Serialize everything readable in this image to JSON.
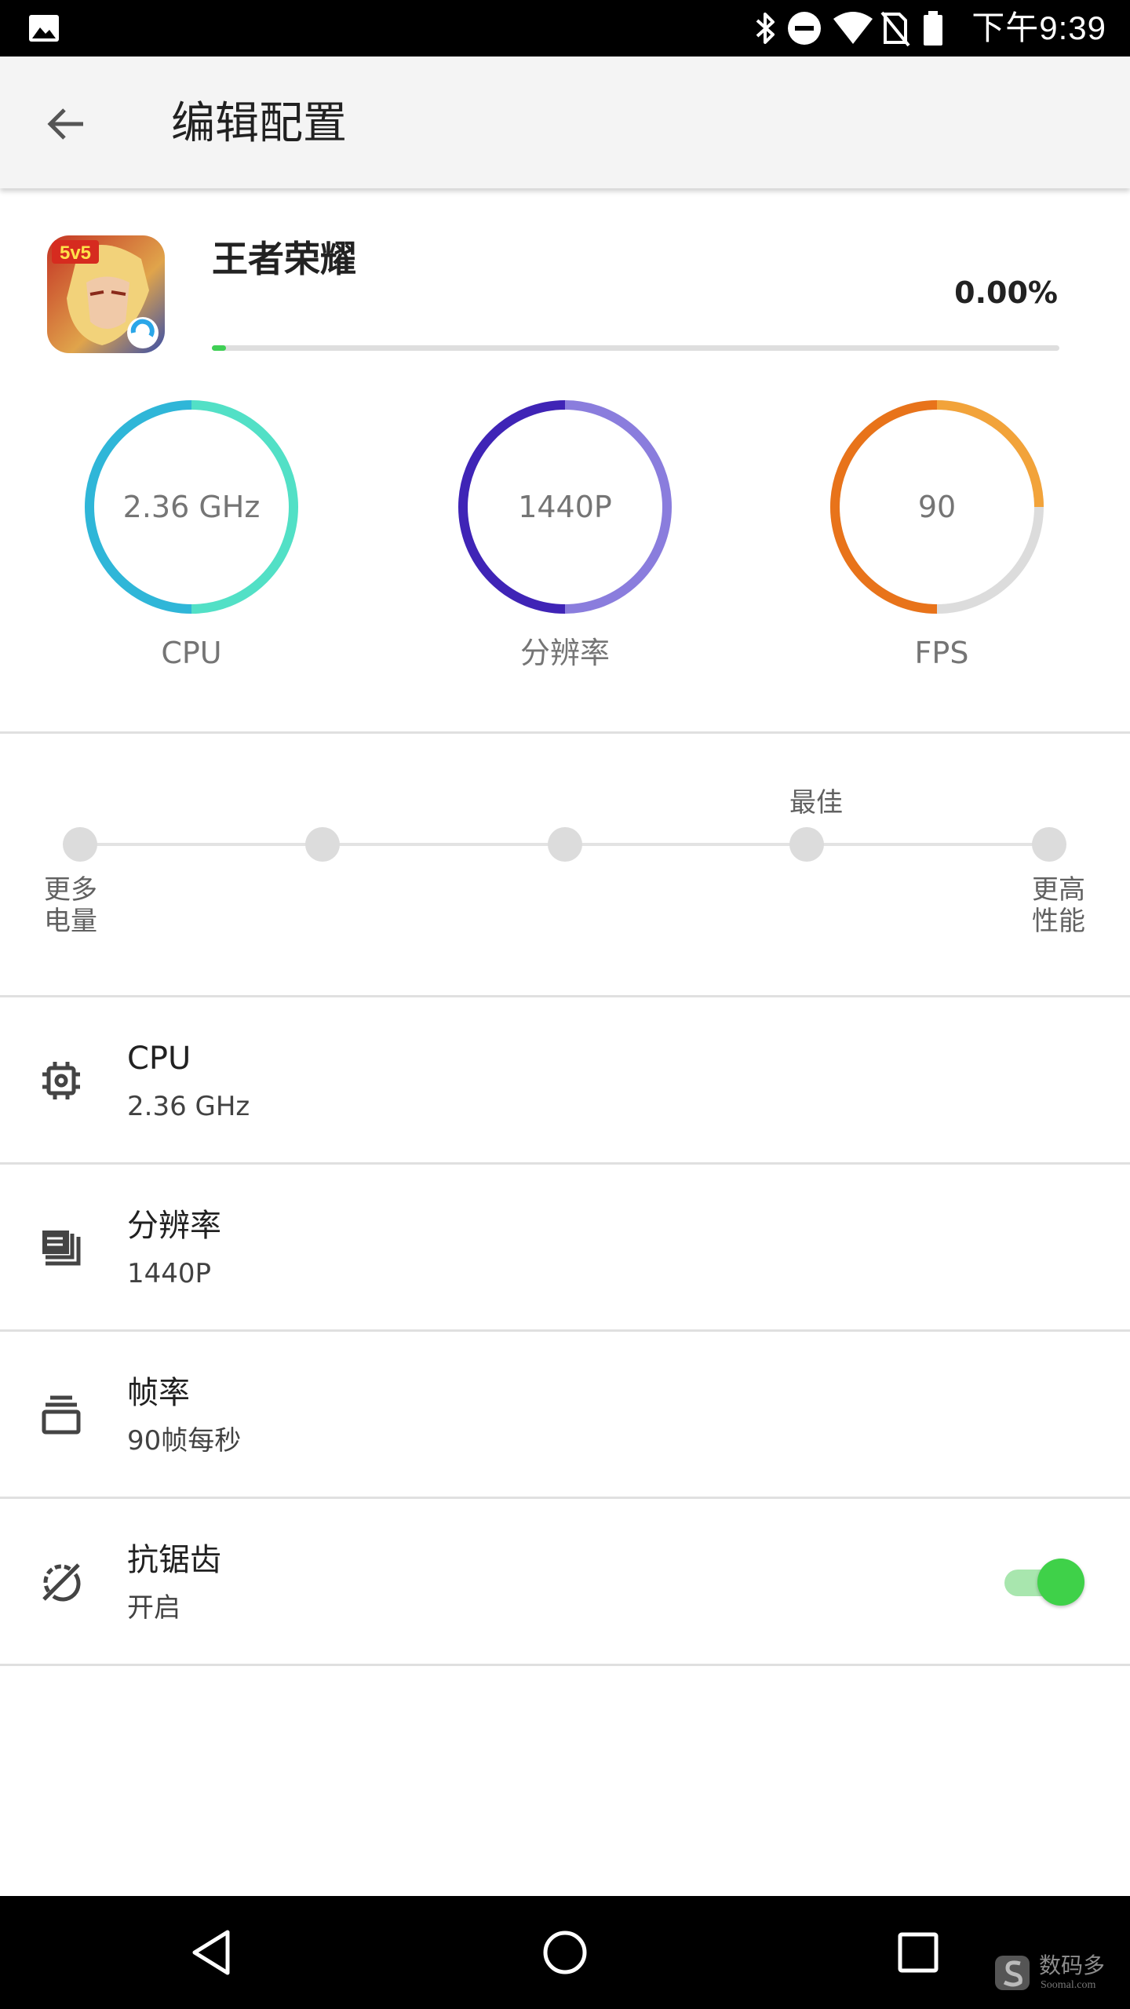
{
  "status_bar": {
    "time": "下午9:39",
    "icons": [
      "gallery-icon",
      "bluetooth-icon",
      "do-not-disturb-icon",
      "wifi-icon",
      "no-sim-icon",
      "battery-icon"
    ]
  },
  "app_bar": {
    "title": "编辑配置",
    "back_icon": "arrow-back-icon"
  },
  "game": {
    "name": "王者荣耀",
    "percent": "0.00%",
    "progress_fraction": 0.0,
    "progress_color": "#3fcf55",
    "icon_badge": "5v5"
  },
  "gauges": [
    {
      "value": "2.36 GHz",
      "label": "CPU",
      "fill_fraction": 1.0,
      "colors": [
        "#25b7d6",
        "#4fe0c4"
      ]
    },
    {
      "value": "1440P",
      "label": "分辨率",
      "fill_fraction": 1.0,
      "colors": [
        "#3a24b8",
        "#8d7de0"
      ]
    },
    {
      "value": "90",
      "label": "FPS",
      "fill_fraction": 0.75,
      "colors": [
        "#e8731a",
        "#f2a33a"
      ]
    }
  ],
  "slider": {
    "stops": 5,
    "best_label": "最佳",
    "best_index": 3,
    "left_label_line1": "更多",
    "left_label_line2": "电量",
    "right_label_line1": "更高",
    "right_label_line2": "性能"
  },
  "settings": [
    {
      "title": "CPU",
      "value": "2.36 GHz",
      "icon": "cpu-chip-icon"
    },
    {
      "title": "分辨率",
      "value": "1440P",
      "icon": "resolution-layers-icon"
    },
    {
      "title": "帧率",
      "value": "90帧每秒",
      "icon": "frame-stack-icon"
    },
    {
      "title": "抗锯齿",
      "value": "开启",
      "icon": "anti-aliasing-icon",
      "toggle_on": true
    }
  ],
  "nav_bar": {
    "icons": [
      "nav-back-icon",
      "nav-home-icon",
      "nav-recents-icon"
    ]
  },
  "watermark": {
    "text": "数码多",
    "sub": "Soomal.com"
  },
  "colors": {
    "accent_green": "#3fd149",
    "status_bar_bg": "#000000",
    "app_bar_bg": "#f4f4f4"
  }
}
